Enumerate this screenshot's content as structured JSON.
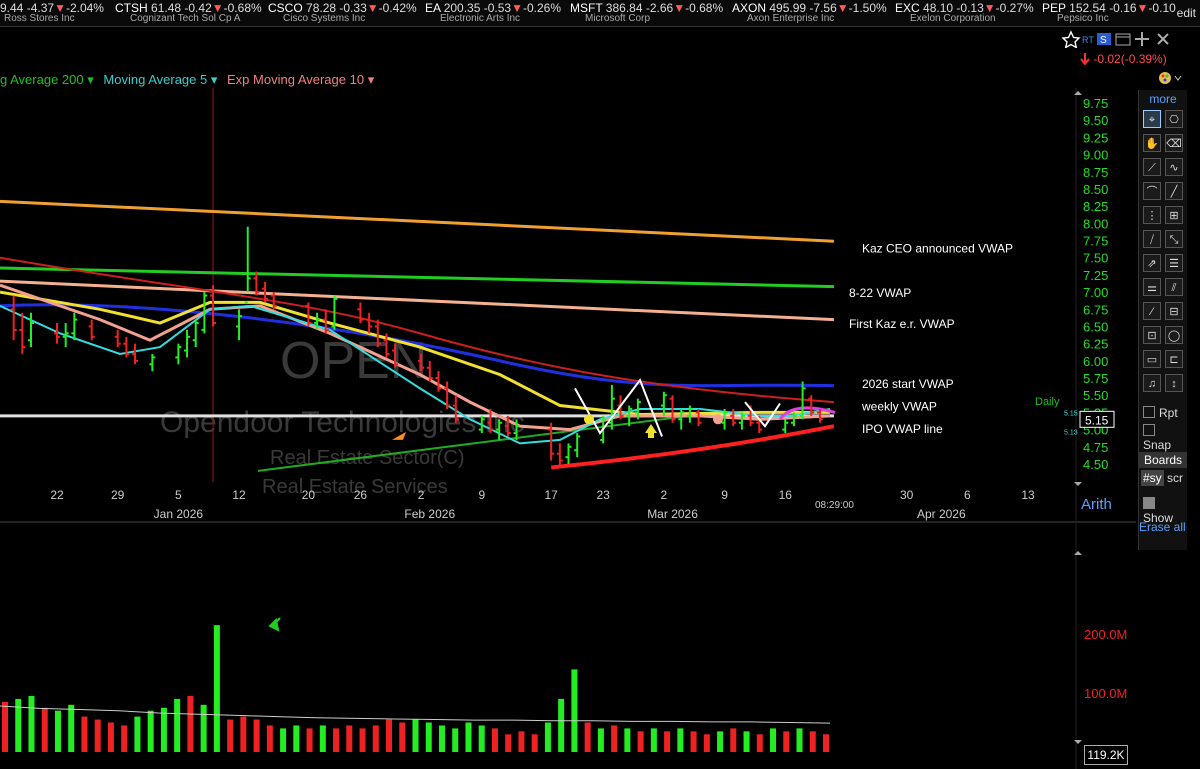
{
  "ticker": [
    {
      "line1_sym": "",
      "line1_price": "9.44",
      "line1_chg": "-4.37",
      "line1_pct": "-2.04%",
      "name": "Ross Stores Inc",
      "left": 0
    },
    {
      "line1_sym": "CTSH",
      "line1_price": "61.48",
      "line1_chg": "-0.42",
      "line1_pct": "-0.68%",
      "name": "Cognizant Tech Sol Cp A",
      "left": 115
    },
    {
      "line1_sym": "CSCO",
      "line1_price": "78.28",
      "line1_chg": "-0.33",
      "line1_pct": "-0.42%",
      "name": "Cisco Systems Inc",
      "left": 268
    },
    {
      "line1_sym": "EA",
      "line1_price": "200.35",
      "line1_chg": "-0.53",
      "line1_pct": "-0.26%",
      "name": "Electronic Arts Inc",
      "left": 425
    },
    {
      "line1_sym": "MSFT",
      "line1_price": "386.84",
      "line1_chg": "-2.66",
      "line1_pct": "-0.68%",
      "name": "Microsoft Corp",
      "left": 570
    },
    {
      "line1_sym": "AXON",
      "line1_price": "495.99",
      "line1_chg": "-7.56",
      "line1_pct": "-1.50%",
      "name": "Axon Enterprise Inc",
      "left": 732
    },
    {
      "line1_sym": "EXC",
      "line1_price": "48.10",
      "line1_chg": "-0.13",
      "line1_pct": "-0.27%",
      "name": "Exelon Corporation",
      "left": 895
    },
    {
      "line1_sym": "PEP",
      "line1_price": "152.54",
      "line1_chg": "-0.16",
      "line1_pct": "-0.10",
      "name": "Pepsico Inc",
      "left": 1042
    }
  ],
  "edit_label": "edit",
  "header": {
    "rt": "RT",
    "change": "-0.02(-0.39%)"
  },
  "legend": {
    "ma200": "g Average 200",
    "ma5": "Moving Average 5",
    "ema10": "Exp Moving Average 10"
  },
  "toolbar": {
    "more": "more",
    "rpt": "Rpt",
    "snap": "Snap",
    "boards": "Boards",
    "sy": "#sy",
    "scr": "scr",
    "show": "Show",
    "erase_all": "Erase all"
  },
  "arith": "Arith",
  "volume_readout": "119.2K",
  "watermark": {
    "symbol": "OPEN",
    "name": "Opendoor Technologies Inc",
    "sector": "Real Estate Sector(C)",
    "industry": "Real Estate Services"
  },
  "chart_data": {
    "type": "candlestick",
    "symbol": "OPEN",
    "period": "Daily",
    "time_label": "08:29:00",
    "last_price": "5.15",
    "price_labels": [
      "5.15",
      "5.13"
    ],
    "y_ticks": [
      "9.75",
      "9.50",
      "9.25",
      "9.00",
      "8.75",
      "8.50",
      "8.25",
      "8.00",
      "7.75",
      "7.50",
      "7.25",
      "7.00",
      "6.75",
      "6.50",
      "6.25",
      "6.00",
      "5.75",
      "5.50",
      "5.25",
      "5.00",
      "4.75",
      "4.50"
    ],
    "ylim": [
      4.5,
      9.75
    ],
    "x_ticks": [
      {
        "label": "22",
        "date": "2025-12-22"
      },
      {
        "label": "29",
        "date": "2025-12-29"
      },
      {
        "label": "5",
        "date": "2026-01-05"
      },
      {
        "label": "12",
        "date": "2026-01-12"
      },
      {
        "label": "20",
        "date": "2026-01-20"
      },
      {
        "label": "26",
        "date": "2026-01-26"
      },
      {
        "label": "2",
        "date": "2026-02-02"
      },
      {
        "label": "9",
        "date": "2026-02-09"
      },
      {
        "label": "17",
        "date": "2026-02-17"
      },
      {
        "label": "23",
        "date": "2026-02-23"
      },
      {
        "label": "2",
        "date": "2026-03-02"
      },
      {
        "label": "9",
        "date": "2026-03-09"
      },
      {
        "label": "16",
        "date": "2026-03-16"
      },
      {
        "label": "30",
        "date": "2026-03-30"
      },
      {
        "label": "6",
        "date": "2026-04-06"
      },
      {
        "label": "13",
        "date": "2026-04-13"
      }
    ],
    "month_labels": [
      {
        "label": "Jan 2026",
        "date": "2026-01-05"
      },
      {
        "label": "Feb 2026",
        "date": "2026-02-03"
      },
      {
        "label": "Mar 2026",
        "date": "2026-03-03"
      },
      {
        "label": "Apr 2026",
        "date": "2026-04-03"
      }
    ],
    "annotations": [
      {
        "text": "Kaz CEO announced VWAP",
        "price": 7.65
      },
      {
        "text": "8-22 VWAP",
        "price": 7.0
      },
      {
        "text": "First Kaz e.r. VWAP",
        "price": 6.55
      },
      {
        "text": "2026 start VWAP",
        "price": 5.68
      },
      {
        "text": "weekly VWAP",
        "price": 5.35
      },
      {
        "text": "IPO VWAP line",
        "price": 5.02
      }
    ],
    "vwap_lines": [
      {
        "name": "Kaz CEO announced VWAP",
        "color": "#f0a030",
        "values": [
          8.32,
          7.74
        ]
      },
      {
        "name": "8-22 VWAP",
        "color": "#22cc22",
        "values": [
          7.35,
          7.08
        ]
      },
      {
        "name": "First Kaz e.r. VWAP",
        "color": "#f5b090",
        "values": [
          7.16,
          6.6
        ]
      },
      {
        "name": "2026 start VWAP",
        "color": "#2030e0",
        "values": [
          6.8,
          5.64
        ]
      },
      {
        "name": "weekly VWAP",
        "color": "#e0e0e0",
        "values": [
          5.2,
          5.2
        ]
      },
      {
        "name": "IPO VWAP line",
        "color": "#ff2020",
        "values": [
          4.45,
          5.05
        ]
      }
    ],
    "candles": [
      {
        "date": "2025-12-17",
        "o": 6.75,
        "h": 6.95,
        "l": 6.3,
        "c": 6.45
      },
      {
        "date": "2025-12-18",
        "o": 6.45,
        "h": 6.7,
        "l": 6.1,
        "c": 6.2
      },
      {
        "date": "2025-12-19",
        "o": 6.3,
        "h": 6.7,
        "l": 6.2,
        "c": 6.55
      },
      {
        "date": "2025-12-22",
        "o": 6.4,
        "h": 6.55,
        "l": 6.25,
        "c": 6.35
      },
      {
        "date": "2025-12-23",
        "o": 6.35,
        "h": 6.55,
        "l": 6.2,
        "c": 6.4
      },
      {
        "date": "2025-12-24",
        "o": 6.4,
        "h": 6.7,
        "l": 6.3,
        "c": 6.6
      },
      {
        "date": "2025-12-26",
        "o": 6.5,
        "h": 6.6,
        "l": 6.3,
        "c": 6.35
      },
      {
        "date": "2025-12-29",
        "o": 6.35,
        "h": 6.45,
        "l": 6.2,
        "c": 6.25
      },
      {
        "date": "2025-12-30",
        "o": 6.25,
        "h": 6.35,
        "l": 6.05,
        "c": 6.1
      },
      {
        "date": "2025-12-31",
        "o": 6.1,
        "h": 6.25,
        "l": 5.95,
        "c": 6.0
      },
      {
        "date": "2026-01-02",
        "o": 5.95,
        "h": 6.1,
        "l": 5.85,
        "c": 6.05
      },
      {
        "date": "2026-01-05",
        "o": 6.05,
        "h": 6.25,
        "l": 5.95,
        "c": 6.2
      },
      {
        "date": "2026-01-06",
        "o": 6.15,
        "h": 6.45,
        "l": 6.05,
        "c": 6.35
      },
      {
        "date": "2026-01-07",
        "o": 6.3,
        "h": 6.6,
        "l": 6.2,
        "c": 6.55
      },
      {
        "date": "2026-01-08",
        "o": 6.45,
        "h": 7.0,
        "l": 6.4,
        "c": 6.95
      },
      {
        "date": "2026-01-09",
        "o": 6.95,
        "h": 7.1,
        "l": 6.5,
        "c": 6.55
      },
      {
        "date": "2026-01-12",
        "o": 6.5,
        "h": 6.75,
        "l": 6.3,
        "c": 6.65
      },
      {
        "date": "2026-01-13",
        "o": 6.85,
        "h": 7.95,
        "l": 7.0,
        "c": 7.2
      },
      {
        "date": "2026-01-14",
        "o": 7.2,
        "h": 7.3,
        "l": 6.95,
        "c": 7.0
      },
      {
        "date": "2026-01-15",
        "o": 7.05,
        "h": 7.15,
        "l": 6.85,
        "c": 6.9
      },
      {
        "date": "2026-01-16",
        "o": 6.95,
        "h": 7.0,
        "l": 6.75,
        "c": 6.8
      },
      {
        "date": "2026-01-20",
        "o": 6.8,
        "h": 6.85,
        "l": 6.5,
        "c": 6.55
      },
      {
        "date": "2026-01-21",
        "o": 6.55,
        "h": 6.7,
        "l": 6.45,
        "c": 6.6
      },
      {
        "date": "2026-01-22",
        "o": 6.6,
        "h": 6.75,
        "l": 6.4,
        "c": 6.45
      },
      {
        "date": "2026-01-23",
        "o": 6.5,
        "h": 6.95,
        "l": 6.45,
        "c": 6.9
      },
      {
        "date": "2026-01-26",
        "o": 6.75,
        "h": 6.85,
        "l": 6.55,
        "c": 6.6
      },
      {
        "date": "2026-01-27",
        "o": 6.6,
        "h": 6.7,
        "l": 6.4,
        "c": 6.5
      },
      {
        "date": "2026-01-28",
        "o": 6.5,
        "h": 6.6,
        "l": 6.2,
        "c": 6.25
      },
      {
        "date": "2026-01-29",
        "o": 6.3,
        "h": 6.4,
        "l": 6.05,
        "c": 6.1
      },
      {
        "date": "2026-01-30",
        "o": 6.15,
        "h": 6.25,
        "l": 5.9,
        "c": 5.95
      },
      {
        "date": "2026-02-02",
        "o": 6.0,
        "h": 6.1,
        "l": 5.85,
        "c": 5.9
      },
      {
        "date": "2026-02-03",
        "o": 5.9,
        "h": 6.0,
        "l": 5.7,
        "c": 5.75
      },
      {
        "date": "2026-02-04",
        "o": 5.75,
        "h": 5.85,
        "l": 5.55,
        "c": 5.6
      },
      {
        "date": "2026-02-05",
        "o": 5.6,
        "h": 5.7,
        "l": 5.3,
        "c": 5.35
      },
      {
        "date": "2026-02-06",
        "o": 5.35,
        "h": 5.5,
        "l": 5.1,
        "c": 5.15
      },
      {
        "date": "2026-02-09",
        "o": 5.0,
        "h": 5.2,
        "l": 4.95,
        "c": 5.15
      },
      {
        "date": "2026-02-10",
        "o": 5.1,
        "h": 5.3,
        "l": 4.95,
        "c": 5.0
      },
      {
        "date": "2026-02-11",
        "o": 5.0,
        "h": 5.15,
        "l": 4.85,
        "c": 5.1
      },
      {
        "date": "2026-02-12",
        "o": 5.05,
        "h": 5.2,
        "l": 4.9,
        "c": 4.95
      },
      {
        "date": "2026-02-13",
        "o": 4.95,
        "h": 5.15,
        "l": 4.85,
        "c": 5.05
      },
      {
        "date": "2026-02-17",
        "o": 5.0,
        "h": 5.1,
        "l": 4.55,
        "c": 4.65
      },
      {
        "date": "2026-02-18",
        "o": 4.65,
        "h": 4.8,
        "l": 4.45,
        "c": 4.55
      },
      {
        "date": "2026-02-19",
        "o": 4.6,
        "h": 4.8,
        "l": 4.5,
        "c": 4.75
      },
      {
        "date": "2026-02-20",
        "o": 4.7,
        "h": 4.95,
        "l": 4.6,
        "c": 4.9
      },
      {
        "date": "2026-02-23",
        "o": 4.85,
        "h": 5.2,
        "l": 4.8,
        "c": 5.15
      },
      {
        "date": "2026-02-24",
        "o": 5.1,
        "h": 5.65,
        "l": 5.0,
        "c": 5.45
      },
      {
        "date": "2026-02-25",
        "o": 5.35,
        "h": 5.5,
        "l": 5.15,
        "c": 5.2
      },
      {
        "date": "2026-02-26",
        "o": 5.2,
        "h": 5.35,
        "l": 5.05,
        "c": 5.3
      },
      {
        "date": "2026-02-27",
        "o": 5.25,
        "h": 5.45,
        "l": 5.15,
        "c": 5.4
      },
      {
        "date": "2026-03-02",
        "o": 5.35,
        "h": 5.55,
        "l": 5.2,
        "c": 5.5
      },
      {
        "date": "2026-03-03",
        "o": 5.45,
        "h": 5.5,
        "l": 5.1,
        "c": 5.15
      },
      {
        "date": "2026-03-04",
        "o": 5.15,
        "h": 5.3,
        "l": 5.0,
        "c": 5.25
      },
      {
        "date": "2026-03-05",
        "o": 5.2,
        "h": 5.35,
        "l": 5.1,
        "c": 5.3
      },
      {
        "date": "2026-03-06",
        "o": 5.25,
        "h": 5.3,
        "l": 5.05,
        "c": 5.1
      },
      {
        "date": "2026-03-09",
        "o": 5.1,
        "h": 5.3,
        "l": 5.0,
        "c": 5.25
      },
      {
        "date": "2026-03-10",
        "o": 5.2,
        "h": 5.3,
        "l": 5.05,
        "c": 5.1
      },
      {
        "date": "2026-03-11",
        "o": 5.1,
        "h": 5.25,
        "l": 5.0,
        "c": 5.2
      },
      {
        "date": "2026-03-12",
        "o": 5.2,
        "h": 5.35,
        "l": 5.05,
        "c": 5.1
      },
      {
        "date": "2026-03-13",
        "o": 5.1,
        "h": 5.2,
        "l": 4.95,
        "c": 5.0
      },
      {
        "date": "2026-03-16",
        "o": 5.0,
        "h": 5.15,
        "l": 4.95,
        "c": 5.1
      },
      {
        "date": "2026-03-17",
        "o": 5.1,
        "h": 5.25,
        "l": 5.05,
        "c": 5.2
      },
      {
        "date": "2026-03-18",
        "o": 5.2,
        "h": 5.7,
        "l": 5.15,
        "c": 5.6
      },
      {
        "date": "2026-03-19",
        "o": 5.45,
        "h": 5.5,
        "l": 5.2,
        "c": 5.25
      },
      {
        "date": "2026-03-20",
        "o": 5.25,
        "h": 5.3,
        "l": 5.1,
        "c": 5.15
      }
    ],
    "volume": {
      "y_ticks": [
        "200.0M",
        "100.0M"
      ],
      "ylim": [
        0,
        250
      ],
      "unit": "M",
      "values": [
        {
          "v": 85,
          "up": false
        },
        {
          "v": 90,
          "up": true
        },
        {
          "v": 95,
          "up": true
        },
        {
          "v": 75,
          "up": false
        },
        {
          "v": 70,
          "up": true
        },
        {
          "v": 80,
          "up": true
        },
        {
          "v": 60,
          "up": false
        },
        {
          "v": 55,
          "up": false
        },
        {
          "v": 50,
          "up": false
        },
        {
          "v": 45,
          "up": false
        },
        {
          "v": 60,
          "up": true
        },
        {
          "v": 70,
          "up": true
        },
        {
          "v": 75,
          "up": true
        },
        {
          "v": 90,
          "up": true
        },
        {
          "v": 95,
          "up": false
        },
        {
          "v": 80,
          "up": true
        },
        {
          "v": 215,
          "up": true
        },
        {
          "v": 55,
          "up": false
        },
        {
          "v": 60,
          "up": false
        },
        {
          "v": 55,
          "up": false
        },
        {
          "v": 45,
          "up": false
        },
        {
          "v": 40,
          "up": true
        },
        {
          "v": 45,
          "up": true
        },
        {
          "v": 40,
          "up": false
        },
        {
          "v": 45,
          "up": true
        },
        {
          "v": 40,
          "up": false
        },
        {
          "v": 45,
          "up": false
        },
        {
          "v": 40,
          "up": false
        },
        {
          "v": 45,
          "up": false
        },
        {
          "v": 55,
          "up": false
        },
        {
          "v": 50,
          "up": false
        },
        {
          "v": 55,
          "up": true
        },
        {
          "v": 50,
          "up": true
        },
        {
          "v": 45,
          "up": true
        },
        {
          "v": 40,
          "up": true
        },
        {
          "v": 50,
          "up": true
        },
        {
          "v": 45,
          "up": true
        },
        {
          "v": 40,
          "up": false
        },
        {
          "v": 30,
          "up": false
        },
        {
          "v": 35,
          "up": false
        },
        {
          "v": 30,
          "up": false
        },
        {
          "v": 50,
          "up": true
        },
        {
          "v": 90,
          "up": true
        },
        {
          "v": 140,
          "up": true
        },
        {
          "v": 50,
          "up": false
        },
        {
          "v": 40,
          "up": true
        },
        {
          "v": 45,
          "up": false
        },
        {
          "v": 40,
          "up": true
        },
        {
          "v": 35,
          "up": false
        },
        {
          "v": 40,
          "up": true
        },
        {
          "v": 35,
          "up": false
        },
        {
          "v": 40,
          "up": true
        },
        {
          "v": 35,
          "up": false
        },
        {
          "v": 30,
          "up": false
        },
        {
          "v": 35,
          "up": true
        },
        {
          "v": 40,
          "up": false
        },
        {
          "v": 35,
          "up": true
        },
        {
          "v": 30,
          "up": false
        },
        {
          "v": 40,
          "up": true
        },
        {
          "v": 35,
          "up": false
        },
        {
          "v": 40,
          "up": true
        },
        {
          "v": 35,
          "up": false
        },
        {
          "v": 30,
          "up": false
        }
      ],
      "avg_line": [
        78,
        74,
        72,
        70,
        66,
        64,
        62,
        60,
        58,
        57,
        56,
        55,
        54,
        54,
        53,
        53,
        52,
        52,
        51,
        51,
        50,
        49
      ]
    }
  }
}
